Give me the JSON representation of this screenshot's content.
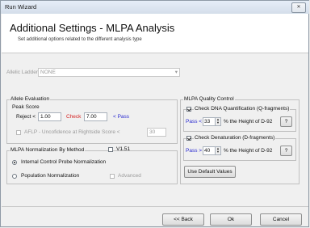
{
  "window": {
    "title": "Run Wizard",
    "close_glyph": "✕"
  },
  "header": {
    "title": "Additional Settings - MLPA Analysis",
    "subtitle": "Set additional options related to the different analysis type"
  },
  "allelic_ladder": {
    "label": "Allelic Ladder",
    "value": "NONE"
  },
  "allele_evaluation": {
    "legend": "Allele Evaluation",
    "peak_score_label": "Peak Score",
    "reject_label": "Reject <",
    "reject_value": "1.00",
    "check_label": "Check",
    "check_value": "7.00",
    "pass_label": "< Pass",
    "aflp_label": "AFLP - Uncofidence at Rightside Score <",
    "aflp_value": "30"
  },
  "normalization": {
    "legend": "MLPA Normalization By Method",
    "v151_label": "V1.51",
    "internal_label": "Internal Control Probe Normalization",
    "population_label": "Population Normalization",
    "advanced_label": "Advanced"
  },
  "quality_control": {
    "legend": "MLPA Quality Control",
    "dna_label": "Check DNA Quantification (Q-fragments)",
    "dna_pass_label": "Pass <",
    "dna_value": "33",
    "dna_suffix": "% the Height of D-92",
    "dna_help": "?",
    "denat_label": "Check Denaturation (D-fragments)",
    "denat_pass_label": "Pass >",
    "denat_value": "40",
    "denat_suffix": "% the Height of D-92",
    "denat_help": "?",
    "default_button": "Use Default Values"
  },
  "footer": {
    "back": "<< Back",
    "ok": "Ok",
    "cancel": "Cancel"
  }
}
